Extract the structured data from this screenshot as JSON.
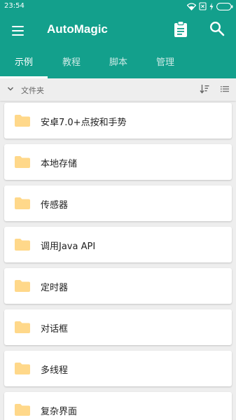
{
  "status_bar": {
    "time": "23:54",
    "icons": [
      "wifi-icon",
      "sim-x-icon",
      "charging-bolt-icon",
      "battery-icon"
    ]
  },
  "app_bar": {
    "title": "AutoMagic",
    "background_color": "#13a08c"
  },
  "tabs": [
    {
      "label": "示例",
      "active": true
    },
    {
      "label": "教程",
      "active": false
    },
    {
      "label": "脚本",
      "active": false
    },
    {
      "label": "管理",
      "active": false
    }
  ],
  "subheader": {
    "label": "文件夹"
  },
  "folders": [
    {
      "label": "安卓7.0+点按和手势"
    },
    {
      "label": "本地存储"
    },
    {
      "label": "传感器"
    },
    {
      "label": "调用Java API"
    },
    {
      "label": "定时器"
    },
    {
      "label": "对话框"
    },
    {
      "label": "多线程"
    },
    {
      "label": "复杂界面"
    }
  ],
  "folder_color": "#ffd88a"
}
